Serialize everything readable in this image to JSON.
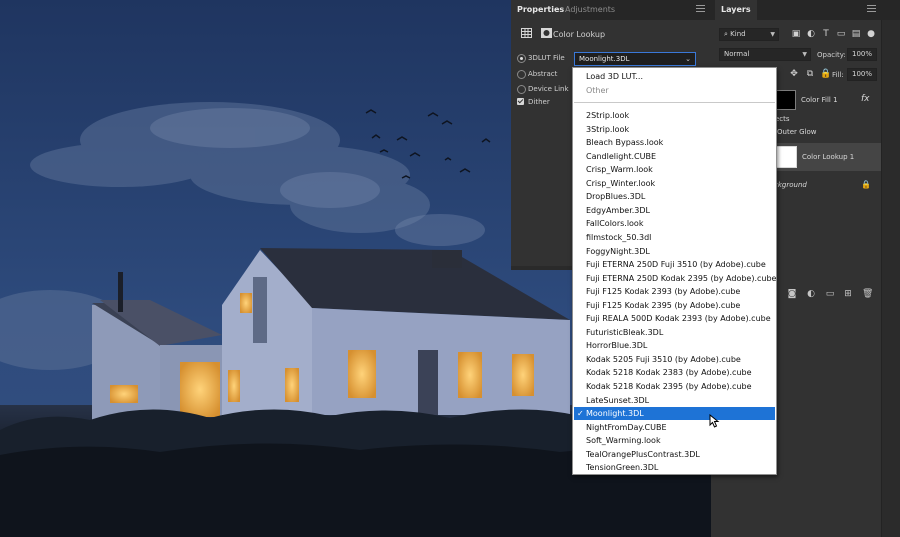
{
  "properties_panel": {
    "tabs": [
      {
        "label": "Properties",
        "active": true
      },
      {
        "label": "Adjustments",
        "active": false
      }
    ],
    "adjustment_title": "Color Lookup",
    "options": {
      "lut_file_label": "3DLUT File",
      "abstract_label": "Abstract",
      "device_link_label": "Device Link",
      "dither_label": "Dither",
      "dither_checked": true
    },
    "selected_lut": "Moonlight.3DL"
  },
  "lut_dropdown": {
    "header_items": [
      "Load 3D LUT...",
      "Other"
    ],
    "items": [
      "2Strip.look",
      "3Strip.look",
      "Bleach Bypass.look",
      "Candlelight.CUBE",
      "Crisp_Warm.look",
      "Crisp_Winter.look",
      "DropBlues.3DL",
      "EdgyAmber.3DL",
      "FallColors.look",
      "filmstock_50.3dl",
      "FoggyNight.3DL",
      "Fuji ETERNA 250D Fuji 3510 (by Adobe).cube",
      "Fuji ETERNA 250D Kodak 2395 (by Adobe).cube",
      "Fuji F125 Kodak 2393 (by Adobe).cube",
      "Fuji F125 Kodak 2395 (by Adobe).cube",
      "Fuji REALA 500D Kodak 2393 (by Adobe).cube",
      "FuturisticBleak.3DL",
      "HorrorBlue.3DL",
      "Kodak 5205 Fuji 3510 (by Adobe).cube",
      "Kodak 5218 Kodak 2383 (by Adobe).cube",
      "Kodak 5218 Kodak 2395 (by Adobe).cube",
      "LateSunset.3DL",
      "Moonlight.3DL",
      "NightFromDay.CUBE",
      "Soft_Warming.look",
      "TealOrangePlusContrast.3DL",
      "TensionGreen.3DL"
    ],
    "selected_index": 22,
    "highlight_color": "#1e73d6"
  },
  "layers_panel": {
    "tab": "Layers",
    "filter_kind": "Kind",
    "blend_mode": "Normal",
    "opacity_label": "Opacity:",
    "opacity_value": "100%",
    "fill_label": "Fill:",
    "fill_value": "100%",
    "layers": [
      {
        "name": "Color Fill 1",
        "fx": "fx"
      },
      {
        "name": "Outer Glow",
        "effects_label": "ects"
      },
      {
        "name": "Color Lookup 1",
        "selected": true
      },
      {
        "name": "ckground"
      }
    ]
  }
}
